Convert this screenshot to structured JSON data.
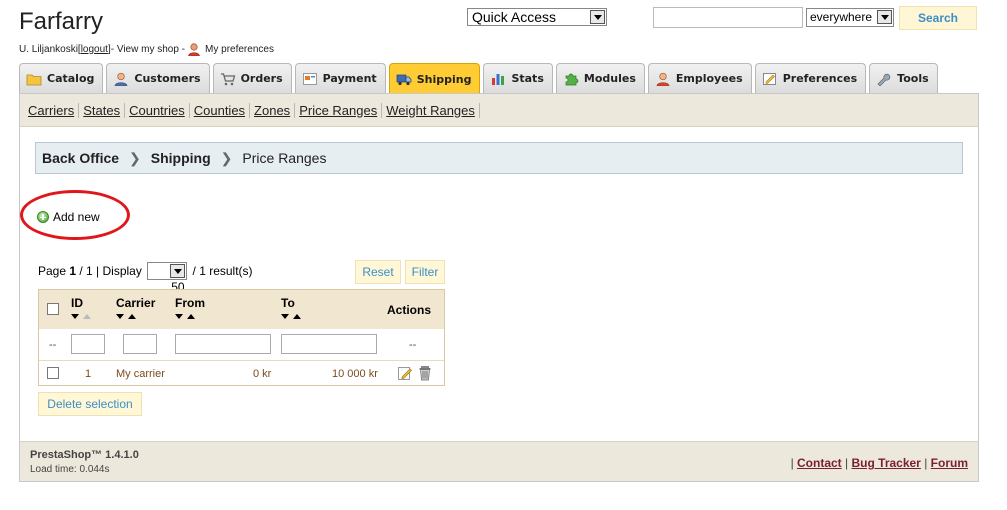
{
  "header": {
    "shop_name": "Farfarry",
    "user_name": "U. Liljankoski",
    "bracket_open": " [",
    "logout_label": "logout",
    "bracket_close": "]",
    "view_shop_label": " - View my shop - ",
    "preferences_label": "My preferences",
    "quick_access_label": "Quick Access",
    "search_value": "",
    "search_scope": "everywhere",
    "search_button": "Search"
  },
  "tabs": [
    {
      "label": "Catalog",
      "icon": "folder-icon"
    },
    {
      "label": "Customers",
      "icon": "user-icon"
    },
    {
      "label": "Orders",
      "icon": "cart-icon"
    },
    {
      "label": "Payment",
      "icon": "payment-icon"
    },
    {
      "label": "Shipping",
      "icon": "truck-icon",
      "active": true
    },
    {
      "label": "Stats",
      "icon": "chart-icon"
    },
    {
      "label": "Modules",
      "icon": "puzzle-icon"
    },
    {
      "label": "Employees",
      "icon": "employee-icon"
    },
    {
      "label": "Preferences",
      "icon": "preferences-icon"
    },
    {
      "label": "Tools",
      "icon": "wrench-icon"
    }
  ],
  "subnav": [
    "Carriers",
    "States",
    "Countries",
    "Counties",
    "Zones",
    "Price Ranges",
    "Weight Ranges"
  ],
  "breadcrumb": {
    "level1": "Back Office",
    "level2": "Shipping",
    "level3": "Price Ranges",
    "separator": "❯"
  },
  "actions": {
    "add_new": "Add new"
  },
  "pager": {
    "page_label": "Page ",
    "page_current": "1",
    "page_total_text": " / 1 | Display ",
    "per_page": "50",
    "results_text": " / 1 result(s)",
    "reset": "Reset",
    "filter": "Filter"
  },
  "table": {
    "columns": {
      "id": "ID",
      "carrier": "Carrier",
      "from": "From",
      "to": "To",
      "actions": "Actions"
    },
    "filter_dash": "--",
    "rows": [
      {
        "id": "1",
        "carrier": "My carrier",
        "from": "0 kr",
        "to": "10 000 kr"
      }
    ],
    "delete_selection": "Delete selection"
  },
  "footer": {
    "version": "PrestaShop™ 1.4.1.0",
    "load_time": "Load time: 0.044s",
    "sep": "| ",
    "contact": "Contact",
    "bug_tracker": "Bug Tracker",
    "forum": "Forum"
  },
  "colors": {
    "active_tab": "#ffcc33",
    "link_blue": "#3a8fc7",
    "annotation_red": "#e0161b",
    "row_text": "#7a4b1d"
  }
}
